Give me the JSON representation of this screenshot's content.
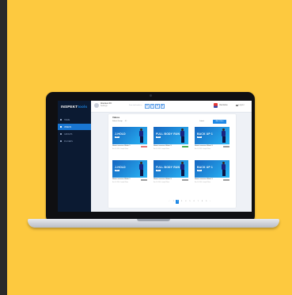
{
  "app": {
    "brand_a": "INSPEKT",
    "brand_b": "tools"
  },
  "nav": [
    {
      "label": "HOME",
      "active": false
    },
    {
      "label": "VIDEOS",
      "active": true
    },
    {
      "label": "GROUPS",
      "active": false
    },
    {
      "label": "PLAYERS",
      "active": false
    }
  ],
  "topbar": {
    "company": "Aberdeen FC",
    "company_sub": "Settings",
    "trial_label": "Free trial ends in",
    "timer": [
      "0",
      "7",
      "8",
      "6"
    ],
    "user": "Username",
    "logout": "Logout"
  },
  "content": {
    "title": "Videos",
    "filter_label": "Select Group",
    "filter_value": "All",
    "sort_label": "Latest",
    "add_label": "Add Video",
    "cards": [
      {
        "thumb_title": "J-HOLD",
        "tag": "NEW",
        "caption": "Home exercise Week 1",
        "badge": "Draft",
        "badge_color": "#e57373",
        "meta": "Nov 14, 2019 • Joseph Wilson"
      },
      {
        "thumb_title": "FULL BODY RUN",
        "tag": "NEW",
        "caption": "Home exercise Week 3",
        "badge": "Public",
        "badge_color": "#4caf50",
        "meta": "Nov 14, 2019 • Joseph Wilson"
      },
      {
        "thumb_title": "BACK UP 1",
        "tag": "NEW",
        "caption": "Home exercise Week 3",
        "badge": "Hidden",
        "badge_color": "#9e9e9e",
        "meta": "Nov 14, 2019 • Joseph Wilson"
      },
      {
        "thumb_title": "J-HOLD",
        "tag": "NEW",
        "caption": "Home exercise Week 1",
        "badge": "Hidden",
        "badge_color": "#9e9e9e",
        "meta": "Nov 14, 2019 • Joseph Wilson"
      },
      {
        "thumb_title": "FULL BODY RUN",
        "tag": "NEW",
        "caption": "Home exercise Week 3",
        "badge": "Hidden",
        "badge_color": "#9e9e9e",
        "meta": "Nov 14, 2019 • Joseph Wilson"
      },
      {
        "thumb_title": "BACK UP 1",
        "tag": "NEW",
        "caption": "Home exercise Week 3",
        "badge": "Hidden",
        "badge_color": "#9e9e9e",
        "meta": "Nov 14, 2019 • Joseph Wilson"
      }
    ],
    "pages": [
      "‹",
      "1",
      "2",
      "3",
      "4",
      "5",
      "6",
      "7",
      "8",
      "9",
      "›"
    ],
    "active_page": "2"
  },
  "colors": {
    "accent": "#1e88e5",
    "sidebar": "#0b1a32",
    "background": "#fdc93f"
  }
}
